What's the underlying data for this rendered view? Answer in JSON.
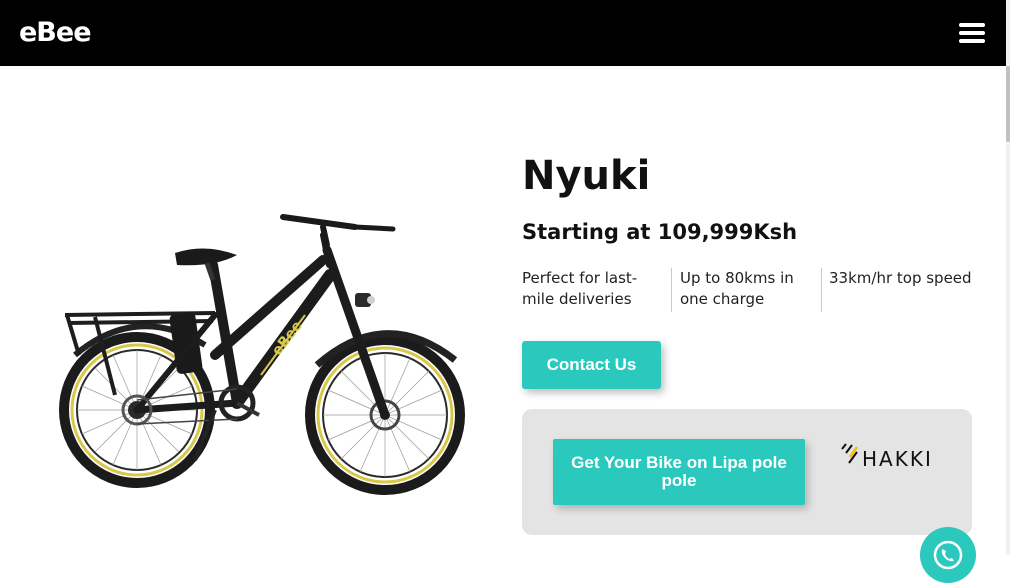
{
  "header": {
    "logo_text": "eBee",
    "menu_icon": "hamburger-menu-icon"
  },
  "product": {
    "name": "Nyuki",
    "price_text": "Starting at 109,999Ksh",
    "image_icon": "electric-bike-image",
    "bike_decal": "eBee",
    "features": [
      {
        "label": "Perfect for last-mile deliveries"
      },
      {
        "label": "Up to 80kms in one charge"
      },
      {
        "label": "33km/hr top speed"
      }
    ]
  },
  "cta": {
    "contact_label": "Contact Us",
    "lipa_label": "Get Your Bike on Lipa pole pole",
    "partner_logo_text": "HAKKI"
  },
  "whatsapp": {
    "icon": "whatsapp-icon"
  },
  "colors": {
    "header_bg": "#000000",
    "accent": "#2bc8be",
    "panel_bg": "#e4e4e4",
    "rim_yellow": "#d8c84a"
  }
}
